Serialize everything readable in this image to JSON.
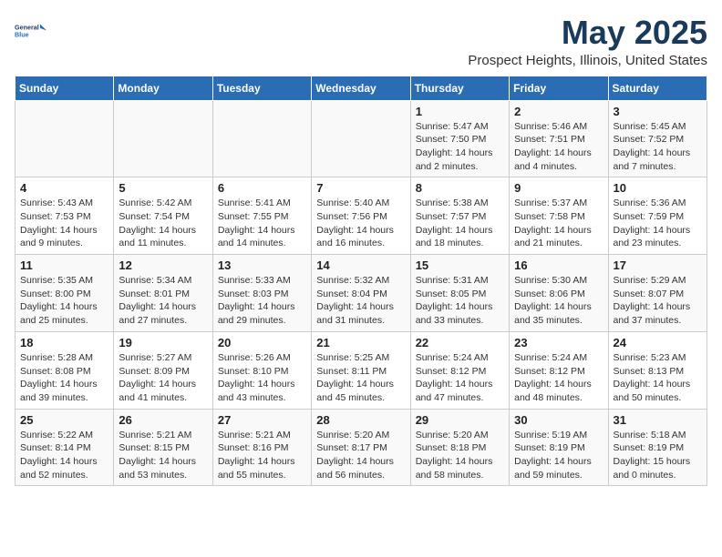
{
  "logo": {
    "line1": "General",
    "line2": "Blue"
  },
  "title": "May 2025",
  "subtitle": "Prospect Heights, Illinois, United States",
  "days": [
    "Sunday",
    "Monday",
    "Tuesday",
    "Wednesday",
    "Thursday",
    "Friday",
    "Saturday"
  ],
  "weeks": [
    [
      {
        "date": "",
        "sunrise": "",
        "sunset": "",
        "daylight": ""
      },
      {
        "date": "",
        "sunrise": "",
        "sunset": "",
        "daylight": ""
      },
      {
        "date": "",
        "sunrise": "",
        "sunset": "",
        "daylight": ""
      },
      {
        "date": "",
        "sunrise": "",
        "sunset": "",
        "daylight": ""
      },
      {
        "date": "1",
        "sunrise": "Sunrise: 5:47 AM",
        "sunset": "Sunset: 7:50 PM",
        "daylight": "Daylight: 14 hours and 2 minutes."
      },
      {
        "date": "2",
        "sunrise": "Sunrise: 5:46 AM",
        "sunset": "Sunset: 7:51 PM",
        "daylight": "Daylight: 14 hours and 4 minutes."
      },
      {
        "date": "3",
        "sunrise": "Sunrise: 5:45 AM",
        "sunset": "Sunset: 7:52 PM",
        "daylight": "Daylight: 14 hours and 7 minutes."
      }
    ],
    [
      {
        "date": "4",
        "sunrise": "Sunrise: 5:43 AM",
        "sunset": "Sunset: 7:53 PM",
        "daylight": "Daylight: 14 hours and 9 minutes."
      },
      {
        "date": "5",
        "sunrise": "Sunrise: 5:42 AM",
        "sunset": "Sunset: 7:54 PM",
        "daylight": "Daylight: 14 hours and 11 minutes."
      },
      {
        "date": "6",
        "sunrise": "Sunrise: 5:41 AM",
        "sunset": "Sunset: 7:55 PM",
        "daylight": "Daylight: 14 hours and 14 minutes."
      },
      {
        "date": "7",
        "sunrise": "Sunrise: 5:40 AM",
        "sunset": "Sunset: 7:56 PM",
        "daylight": "Daylight: 14 hours and 16 minutes."
      },
      {
        "date": "8",
        "sunrise": "Sunrise: 5:38 AM",
        "sunset": "Sunset: 7:57 PM",
        "daylight": "Daylight: 14 hours and 18 minutes."
      },
      {
        "date": "9",
        "sunrise": "Sunrise: 5:37 AM",
        "sunset": "Sunset: 7:58 PM",
        "daylight": "Daylight: 14 hours and 21 minutes."
      },
      {
        "date": "10",
        "sunrise": "Sunrise: 5:36 AM",
        "sunset": "Sunset: 7:59 PM",
        "daylight": "Daylight: 14 hours and 23 minutes."
      }
    ],
    [
      {
        "date": "11",
        "sunrise": "Sunrise: 5:35 AM",
        "sunset": "Sunset: 8:00 PM",
        "daylight": "Daylight: 14 hours and 25 minutes."
      },
      {
        "date": "12",
        "sunrise": "Sunrise: 5:34 AM",
        "sunset": "Sunset: 8:01 PM",
        "daylight": "Daylight: 14 hours and 27 minutes."
      },
      {
        "date": "13",
        "sunrise": "Sunrise: 5:33 AM",
        "sunset": "Sunset: 8:03 PM",
        "daylight": "Daylight: 14 hours and 29 minutes."
      },
      {
        "date": "14",
        "sunrise": "Sunrise: 5:32 AM",
        "sunset": "Sunset: 8:04 PM",
        "daylight": "Daylight: 14 hours and 31 minutes."
      },
      {
        "date": "15",
        "sunrise": "Sunrise: 5:31 AM",
        "sunset": "Sunset: 8:05 PM",
        "daylight": "Daylight: 14 hours and 33 minutes."
      },
      {
        "date": "16",
        "sunrise": "Sunrise: 5:30 AM",
        "sunset": "Sunset: 8:06 PM",
        "daylight": "Daylight: 14 hours and 35 minutes."
      },
      {
        "date": "17",
        "sunrise": "Sunrise: 5:29 AM",
        "sunset": "Sunset: 8:07 PM",
        "daylight": "Daylight: 14 hours and 37 minutes."
      }
    ],
    [
      {
        "date": "18",
        "sunrise": "Sunrise: 5:28 AM",
        "sunset": "Sunset: 8:08 PM",
        "daylight": "Daylight: 14 hours and 39 minutes."
      },
      {
        "date": "19",
        "sunrise": "Sunrise: 5:27 AM",
        "sunset": "Sunset: 8:09 PM",
        "daylight": "Daylight: 14 hours and 41 minutes."
      },
      {
        "date": "20",
        "sunrise": "Sunrise: 5:26 AM",
        "sunset": "Sunset: 8:10 PM",
        "daylight": "Daylight: 14 hours and 43 minutes."
      },
      {
        "date": "21",
        "sunrise": "Sunrise: 5:25 AM",
        "sunset": "Sunset: 8:11 PM",
        "daylight": "Daylight: 14 hours and 45 minutes."
      },
      {
        "date": "22",
        "sunrise": "Sunrise: 5:24 AM",
        "sunset": "Sunset: 8:12 PM",
        "daylight": "Daylight: 14 hours and 47 minutes."
      },
      {
        "date": "23",
        "sunrise": "Sunrise: 5:24 AM",
        "sunset": "Sunset: 8:12 PM",
        "daylight": "Daylight: 14 hours and 48 minutes."
      },
      {
        "date": "24",
        "sunrise": "Sunrise: 5:23 AM",
        "sunset": "Sunset: 8:13 PM",
        "daylight": "Daylight: 14 hours and 50 minutes."
      }
    ],
    [
      {
        "date": "25",
        "sunrise": "Sunrise: 5:22 AM",
        "sunset": "Sunset: 8:14 PM",
        "daylight": "Daylight: 14 hours and 52 minutes."
      },
      {
        "date": "26",
        "sunrise": "Sunrise: 5:21 AM",
        "sunset": "Sunset: 8:15 PM",
        "daylight": "Daylight: 14 hours and 53 minutes."
      },
      {
        "date": "27",
        "sunrise": "Sunrise: 5:21 AM",
        "sunset": "Sunset: 8:16 PM",
        "daylight": "Daylight: 14 hours and 55 minutes."
      },
      {
        "date": "28",
        "sunrise": "Sunrise: 5:20 AM",
        "sunset": "Sunset: 8:17 PM",
        "daylight": "Daylight: 14 hours and 56 minutes."
      },
      {
        "date": "29",
        "sunrise": "Sunrise: 5:20 AM",
        "sunset": "Sunset: 8:18 PM",
        "daylight": "Daylight: 14 hours and 58 minutes."
      },
      {
        "date": "30",
        "sunrise": "Sunrise: 5:19 AM",
        "sunset": "Sunset: 8:19 PM",
        "daylight": "Daylight: 14 hours and 59 minutes."
      },
      {
        "date": "31",
        "sunrise": "Sunrise: 5:18 AM",
        "sunset": "Sunset: 8:19 PM",
        "daylight": "Daylight: 15 hours and 0 minutes."
      }
    ]
  ]
}
